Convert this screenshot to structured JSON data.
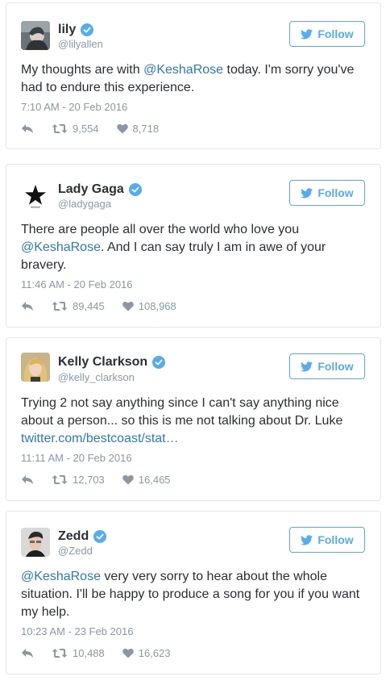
{
  "colors": {
    "accent": "#55acee",
    "link": "#2b7bb9",
    "muted": "#8899a6",
    "text": "#292f33",
    "border": "#e1e8ed"
  },
  "tweets": [
    {
      "display_name": "lily",
      "handle": "@lilyallen",
      "follow_label": "Follow",
      "text_parts": [
        "My thoughts are with ",
        "@KeshaRose",
        " today. I'm sorry you've had to endure this experience."
      ],
      "timestamp": "7:10 AM - 20 Feb 2016",
      "retweets": "9,554",
      "likes": "8,718"
    },
    {
      "display_name": "Lady Gaga",
      "handle": "@ladygaga",
      "follow_label": "Follow",
      "text_parts": [
        "There are people all over the world who love you ",
        "@KeshaRose",
        ". And I can say truly I am in awe of your bravery."
      ],
      "timestamp": "11:46 AM - 20 Feb 2016",
      "retweets": "89,445",
      "likes": "108,968"
    },
    {
      "display_name": "Kelly Clarkson",
      "handle": "@kelly_clarkson",
      "follow_label": "Follow",
      "text_parts": [
        "Trying 2 not say anything since I can't say anything nice about a person... so this is me not talking about Dr. Luke ",
        "twitter.com/bestcoast/stat…"
      ],
      "timestamp": "11:11 AM - 20 Feb 2016",
      "retweets": "12,703",
      "likes": "16,465"
    },
    {
      "display_name": "Zedd",
      "handle": "@Zedd",
      "follow_label": "Follow",
      "text_parts": [
        "@KeshaRose",
        " very very sorry to hear about the whole situation. I'll be happy to produce a song for you if you want my help."
      ],
      "timestamp": "10:23 AM - 23 Feb 2016",
      "retweets": "10,488",
      "likes": "16,623"
    }
  ]
}
